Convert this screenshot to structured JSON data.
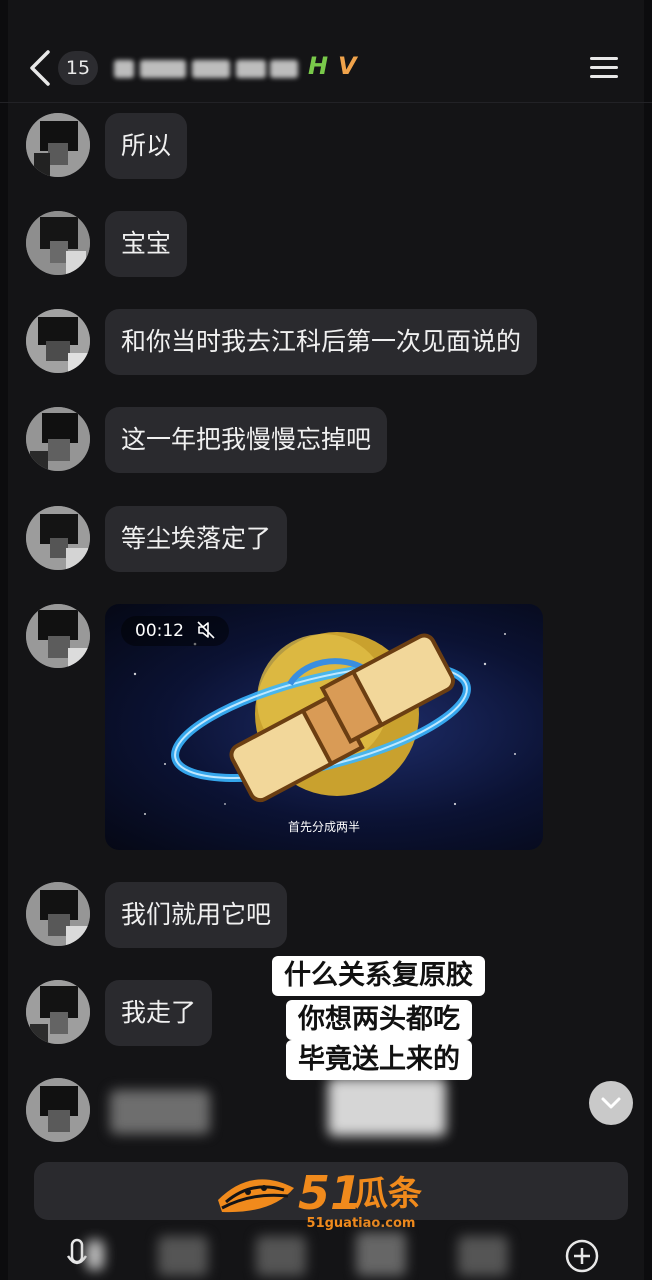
{
  "header": {
    "unread_count": "15",
    "title_emoji_1": "H",
    "title_emoji_2": "V"
  },
  "messages": [
    {
      "text": "所以"
    },
    {
      "text": "宝宝"
    },
    {
      "text": "和你当时我去江科后第一次见面说的"
    },
    {
      "text": "这一年把我慢慢忘掉吧"
    },
    {
      "text": "等尘埃落定了"
    }
  ],
  "video": {
    "duration": "00:12",
    "caption": "首先分成两半"
  },
  "messages_after": [
    {
      "text": "我们就用它吧"
    },
    {
      "text": "我走了"
    }
  ],
  "overlay_captions": [
    "什么关系复原胶",
    "你想两头都吃",
    "毕竟送上来的"
  ],
  "watermark": {
    "brand_number": "51",
    "brand_text": "瓜条",
    "url": "51guatiao.com"
  },
  "colors": {
    "background": "#141416",
    "bubble": "#2a2a2e",
    "watermark": "#f08a1c"
  },
  "icons": [
    "back-arrow-icon",
    "menu-icon",
    "mute-icon",
    "chevron-down-icon",
    "microphone-icon",
    "plus-circle-icon"
  ]
}
